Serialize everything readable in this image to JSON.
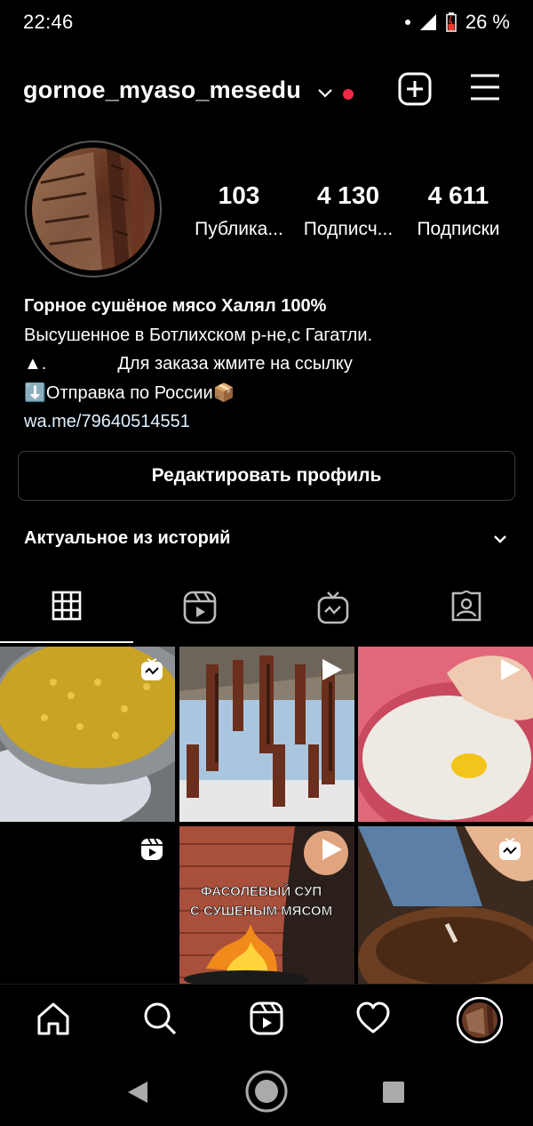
{
  "status_bar": {
    "time": "22:46",
    "battery": "26 %"
  },
  "profile": {
    "username": "gornoe_myaso_mesedu",
    "stats": [
      {
        "value": "103",
        "label": "Публика..."
      },
      {
        "value": "4 130",
        "label": "Подписч..."
      },
      {
        "value": "4 611",
        "label": "Подписки"
      }
    ],
    "bio": {
      "name": "Горное сушёное мясо Халял 100%",
      "line1": "Высушенное в Ботлихском р-не,с Гагатли.",
      "line2_prefix": "▲.",
      "line2_text": "Для заказа жмите на ссылку",
      "line3_icon": "⬇️",
      "line3_text": "Отправка по России",
      "line3_icon2": "📦",
      "link": "wa.me/79640514551"
    },
    "edit_button": "Редактировать профиль",
    "highlights_label": "Актуальное из историй"
  },
  "tabs": [
    {
      "name": "grid-tab",
      "icon": "grid-icon",
      "active": true
    },
    {
      "name": "reels-tab",
      "icon": "reels-icon",
      "active": false
    },
    {
      "name": "igtv-tab",
      "icon": "tv-icon",
      "active": false
    },
    {
      "name": "tagged-tab",
      "icon": "tagged-icon",
      "active": false
    }
  ],
  "posts": [
    {
      "type": "clip",
      "icon": "clip-icon"
    },
    {
      "type": "video",
      "icon": "play-icon"
    },
    {
      "type": "video",
      "icon": "play-icon"
    },
    {
      "type": "reel",
      "icon": "reels-icon"
    },
    {
      "type": "video",
      "icon": "play-icon",
      "overlay": "ФАСОЛЕВЫЙ СУП С СУШЕНЫМ МЯСОМ"
    },
    {
      "type": "clip",
      "icon": "clip-icon"
    }
  ],
  "bottom_nav": [
    "home-icon",
    "search-icon",
    "reels-icon",
    "heart-icon",
    "profile-avatar"
  ],
  "colors": {
    "background": "#000000",
    "notification_dot": "#ee2a45",
    "link": "#e0f1ff"
  }
}
